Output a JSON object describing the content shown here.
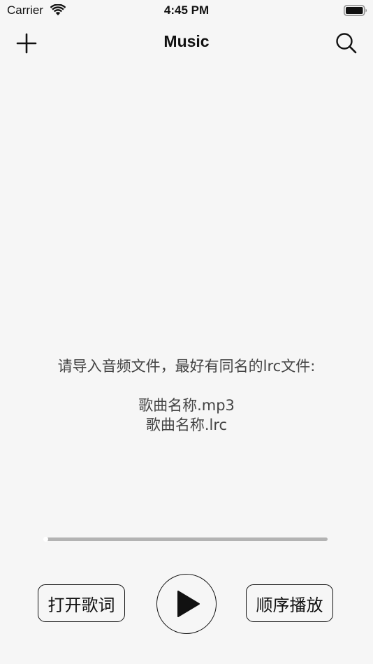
{
  "status_bar": {
    "carrier": "Carrier",
    "time": "4:45 PM",
    "wifi_icon": "wifi-icon",
    "battery_icon": "battery-icon"
  },
  "nav": {
    "title": "Music",
    "left_icon": "plus-icon",
    "right_icon": "search-icon"
  },
  "hint": {
    "line1": "请导入音频文件，最好有同名的lrc文件:",
    "line2": "歌曲名称.mp3",
    "line3": "歌曲名称.lrc"
  },
  "player": {
    "progress": 0,
    "lyrics_button_label": "打开歌词",
    "play_icon": "play-icon",
    "mode_button_label": "顺序播放"
  },
  "colors": {
    "background": "#f6f6f6",
    "text": "#111111",
    "hint_text": "#444444",
    "track": "#b3b3b3"
  }
}
